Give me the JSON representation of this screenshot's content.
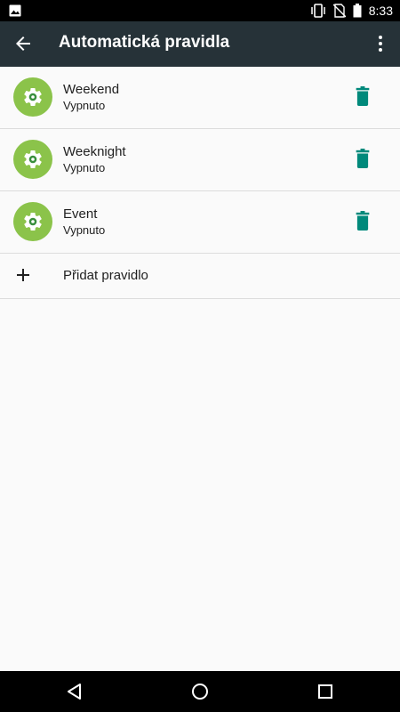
{
  "status_bar": {
    "time": "8:33",
    "icons": [
      "image-notification-icon",
      "vibrate-icon",
      "no-sim-icon",
      "battery-icon"
    ]
  },
  "app_bar": {
    "title": "Automatická pravidla",
    "back_icon": "arrow-back-icon",
    "more_icon": "more-vert-icon"
  },
  "rules": [
    {
      "name": "Weekend",
      "status": "Vypnuto"
    },
    {
      "name": "Weeknight",
      "status": "Vypnuto"
    },
    {
      "name": "Event",
      "status": "Vypnuto"
    }
  ],
  "add_rule": {
    "label": "Přidat pravidlo",
    "icon": "plus-icon"
  },
  "nav": {
    "icons": [
      "back-triangle-icon",
      "home-circle-icon",
      "recents-square-icon"
    ]
  },
  "colors": {
    "app_bar": "#263238",
    "rule_icon_outer": "#8bc34a",
    "rule_icon_inner": "#388e3c",
    "trash": "#00897b"
  }
}
